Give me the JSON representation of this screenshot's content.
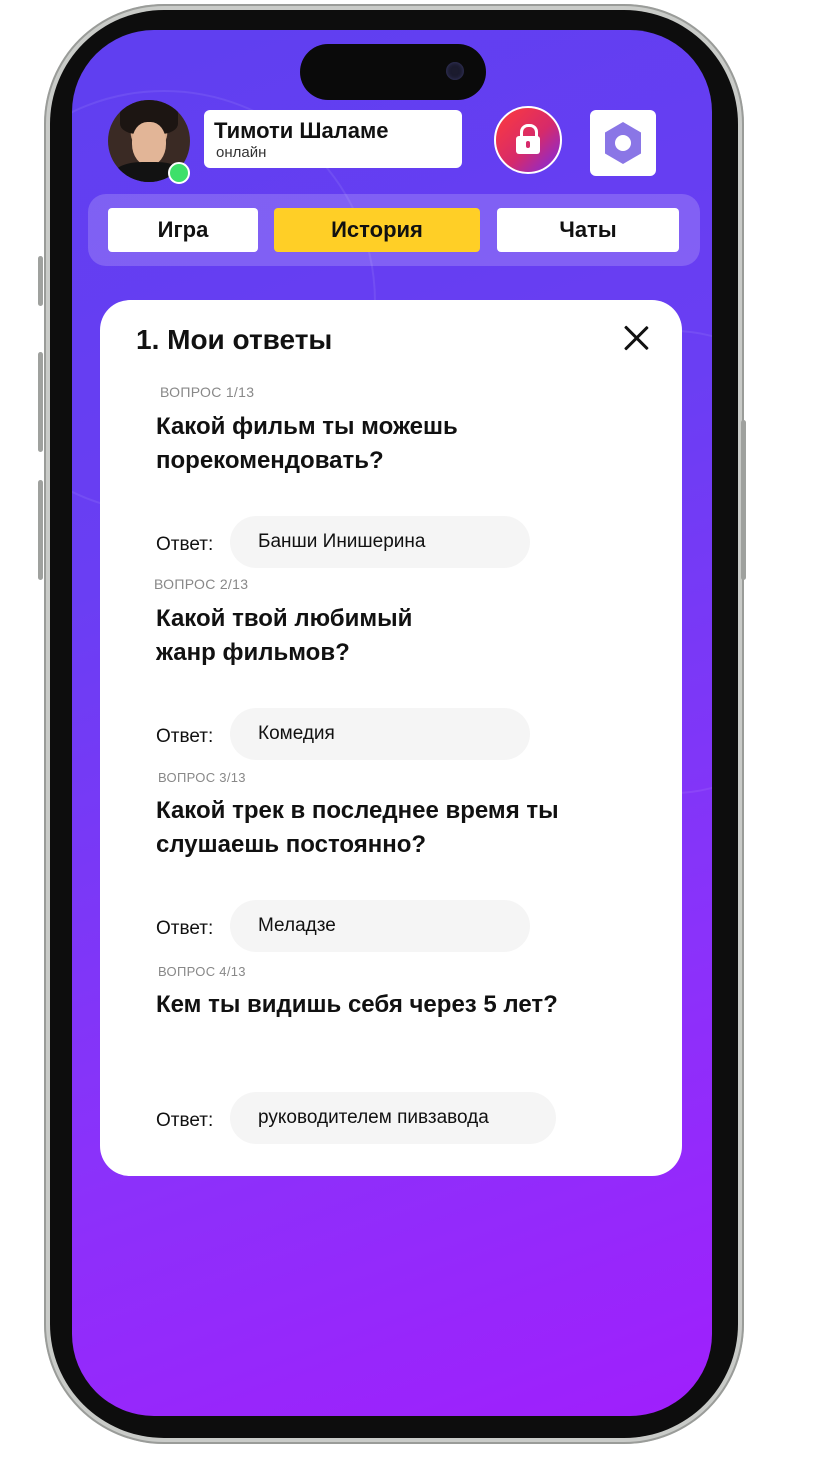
{
  "profile": {
    "name": "Тимоти Шаламе",
    "status": "онлайн",
    "online_color": "#3ee06a"
  },
  "header": {
    "lock_icon": "lock-icon",
    "settings_icon": "hexagon-settings-icon"
  },
  "tabs": [
    {
      "label": "Игра",
      "active": false
    },
    {
      "label": "История",
      "active": true
    },
    {
      "label": "Чаты",
      "active": false
    }
  ],
  "card": {
    "title": "1. Мои ответы",
    "close_icon": "close-icon",
    "answer_label": "Ответ:",
    "questions": [
      {
        "label": "ВОПРОС 1/13",
        "text": "Какой фильм ты можешь порекомендовать?",
        "answer": "Банши Инишерина"
      },
      {
        "label": "ВОПРОС 2/13",
        "text": "Какой твой любимый жанр фильмов?",
        "answer": "Комедия"
      },
      {
        "label": "ВОПРОС 3/13",
        "text": "Какой трек в последнее время ты слушаешь постоянно?",
        "answer": "Меладзе"
      },
      {
        "label": "ВОПРОС 4/13",
        "text": "Кем ты видишь себя через 5 лет?",
        "answer": "руководителем пивзавода"
      }
    ]
  },
  "colors": {
    "accent_yellow": "#ffcf26",
    "gradient_start": "#5f3ff0",
    "gradient_end": "#a01ffc"
  }
}
